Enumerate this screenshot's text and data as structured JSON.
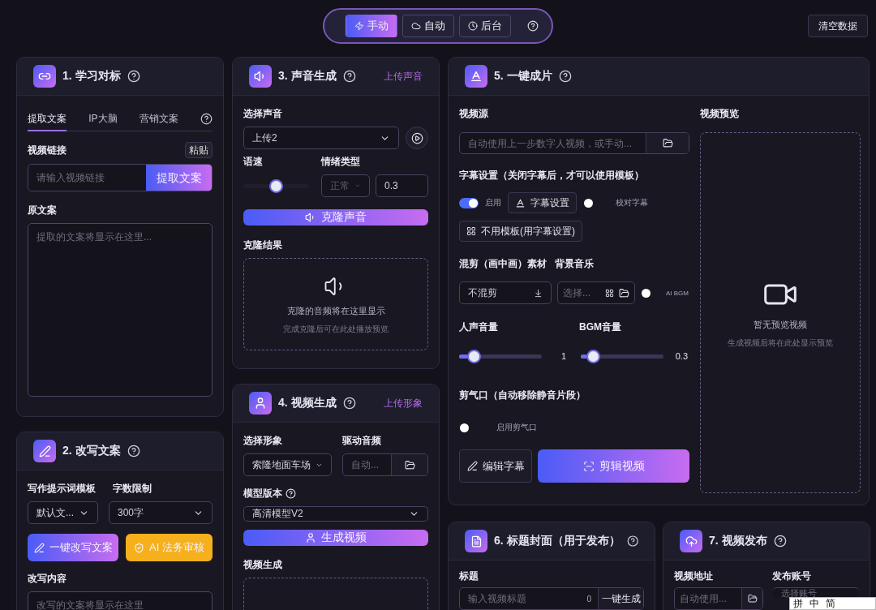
{
  "mode_switch": {
    "tabs": [
      {
        "label": "手动",
        "selected": true
      },
      {
        "label": "自动",
        "selected": false
      },
      {
        "label": "后台",
        "selected": false
      }
    ]
  },
  "clear_button": "清空数据",
  "learn": {
    "title": "1. 学习对标",
    "tabs": [
      {
        "label": "提取文案",
        "selected": true
      },
      {
        "label": "IP大脑",
        "selected": false
      },
      {
        "label": "营销文案",
        "selected": false
      }
    ],
    "link_label": "视频链接",
    "paste_button": "粘贴",
    "link_placeholder": "请输入视频链接",
    "extract_button": "提取文案",
    "source_label": "原文案",
    "source_placeholder": "提取的文案将显示在这里..."
  },
  "rewrite": {
    "title": "2. 改写文案",
    "template_label": "写作提示词模板",
    "template_value": "默认文...",
    "limit_label": "字数限制",
    "limit_value": "300字",
    "rewrite_button": "一键改写文案",
    "audit_button": "AI 法务审核",
    "content_label": "改写内容",
    "content_placeholder": "改写的文案将显示在这里"
  },
  "voice": {
    "title": "3. 声音生成",
    "upload_link": "上传声音",
    "voice_label": "选择声音",
    "voice_value": "上传2",
    "speed_label": "语速",
    "speed": {
      "level": 0.5
    },
    "emotion_label": "情绪类型",
    "emotion_value": "正常",
    "emotion_strength": "0.3",
    "clone_button": "克隆声音",
    "result_label": "克隆结果",
    "result_text": "克隆的音频将在这里显示",
    "result_hint": "完成克隆后可在此处播放预览"
  },
  "video": {
    "title": "4. 视频生成",
    "upload_link": "上传形象",
    "avatar_label": "选择形象",
    "avatar_value": "索隆地面车场",
    "audio_label": "驱动音频",
    "audio_placeholder": "自动...",
    "model_label": "模型版本",
    "model_value": "高清模型V2",
    "generate_button": "生成视频",
    "result_label": "视频生成"
  },
  "edit": {
    "title": "5. 一键成片",
    "source_label": "视频源",
    "source_placeholder": "自动使用上一步数字人视频，或手动...",
    "subtitle_label": "字幕设置（关闭字幕后，才可以使用模板）",
    "subtitle_toggle": {
      "label": "启用",
      "on": true
    },
    "subtitle_settings_button": "字幕设置",
    "proofread_toggle": {
      "label": "校对字幕",
      "on": false
    },
    "template_button": "不用模板(用字幕设置)",
    "mix_label": "混剪（画中画）素材",
    "bgm_label": "背景音乐",
    "mix_value": "不混剪",
    "bgm_placeholder": "选择...",
    "ai_bgm_toggle": {
      "label": "AI BGM",
      "on": false
    },
    "voice_volume": {
      "label": "人声音量",
      "level": 0.18,
      "reading": "1"
    },
    "bgm_volume": {
      "label": "BGM音量",
      "level": 0.15,
      "reading": "0.3"
    },
    "breath_label": "剪气口（自动移除静音片段）",
    "breath_toggle": {
      "label": "启用剪气口",
      "on": false
    },
    "edit_subtitle_button": "编辑字幕",
    "cut_button": "剪辑视频",
    "preview_label": "视频预览",
    "preview_title": "暂无预览视频",
    "preview_hint": "生成视频后将在此处显示预览"
  },
  "title_cover": {
    "title": "6. 标题封面（用于发布）",
    "title_label": "标题",
    "title_placeholder": "输入视频标题",
    "count": "0",
    "generate_button": "一键生成"
  },
  "publish": {
    "title": "7. 视频发布",
    "address_label": "视频地址",
    "address_placeholder": "自动使用...",
    "account_label": "发布账号",
    "account_placeholder": "选择账号"
  },
  "ime_bar": {
    "items": [
      "拼",
      "中",
      "简"
    ]
  }
}
